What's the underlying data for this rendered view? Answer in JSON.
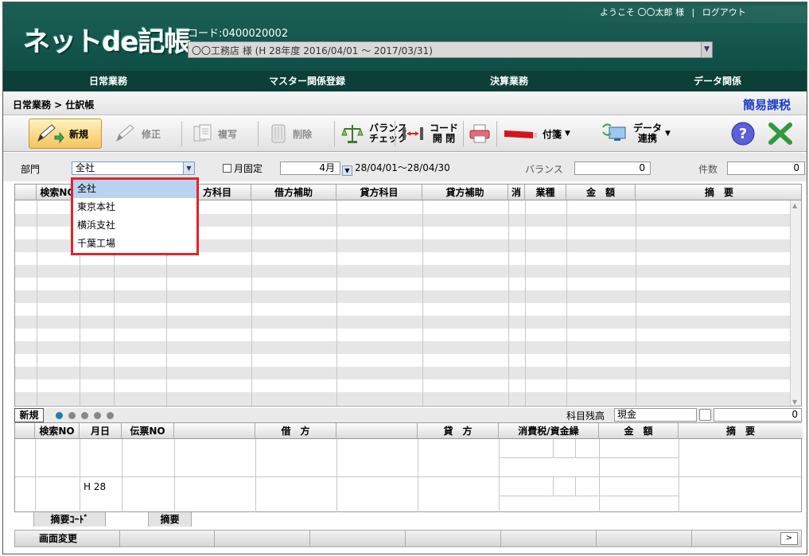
{
  "header": {
    "logo": "ネットde記帳",
    "code": "コード:0400020002",
    "company": "〇〇工務店 様 (H 28年度 2016/04/01 ～ 2017/03/31)",
    "greeting": "ようこそ 〇〇太郎 様",
    "separator": "|",
    "logout": "ログアウト"
  },
  "nav": [
    "日常業務",
    "マスター関係登録",
    "決算業務",
    "データ関係"
  ],
  "breadcrumb": "日常業務 > 仕訳帳",
  "mode_label": "簡易課税",
  "toolbar": {
    "new": "新規",
    "edit": "修正",
    "copy": "複写",
    "delete": "削除",
    "balance_1": "バランス",
    "balance_2": "チェック",
    "code_1": "コード",
    "code_2": "開 閉",
    "tag": "付箋",
    "data_1": "データ",
    "data_2": "連携"
  },
  "filter": {
    "bumon_label": "部門",
    "bumon_value": "全社",
    "month_fix_label": "月固定",
    "month": "4月",
    "date_range": "28/04/01～28/04/30",
    "balance_label": "バランス",
    "balance_value": "0",
    "count_label": "件数",
    "count_value": "0"
  },
  "dropdown": [
    "全社",
    "東京本社",
    "横浜支社",
    "千葉工場"
  ],
  "grid_headers": [
    "検索NO",
    "",
    "",
    "",
    "方科目",
    "借方補助",
    "貸方科目",
    "貸方補助",
    "消",
    "業種",
    "金　額",
    "摘　要"
  ],
  "lower": {
    "new_label": "新規",
    "balance_label": "科目残高",
    "balance_account": "現金",
    "balance_value": "0",
    "headers": [
      "検索NO",
      "月日",
      "伝票NO",
      "",
      "借　方",
      "",
      "貸　方",
      "消費税/資金繰",
      "金　額",
      "摘　要"
    ],
    "era": "H 28"
  },
  "summary": {
    "code_label": "摘要ｺｰﾄﾞ",
    "desc_label": "摘要"
  },
  "status": {
    "screen_change": "画面変更",
    "next": ">"
  }
}
